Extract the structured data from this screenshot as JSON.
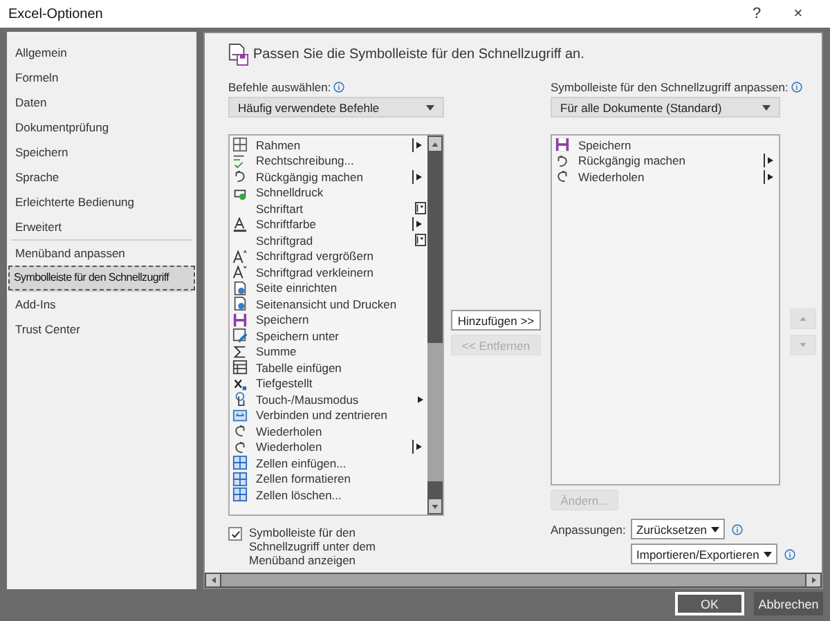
{
  "window": {
    "title": "Excel-Optionen",
    "help": "?",
    "close": "×"
  },
  "sidebar": {
    "groups": [
      [
        {
          "label": "Allgemein",
          "selected": false
        },
        {
          "label": "Formeln",
          "selected": false
        },
        {
          "label": "Daten",
          "selected": false
        },
        {
          "label": "Dokumentprüfung",
          "selected": false
        },
        {
          "label": "Speichern",
          "selected": false
        },
        {
          "label": "Sprache",
          "selected": false
        },
        {
          "label": "Erleichterte Bedienung",
          "selected": false
        },
        {
          "label": "Erweitert",
          "selected": false
        }
      ],
      [
        {
          "label": "Menüband anpassen",
          "selected": false
        },
        {
          "label": "Symbolleiste für den Schnellzugriff",
          "selected": true
        }
      ],
      [
        {
          "label": "Add-Ins",
          "selected": false
        },
        {
          "label": "Trust Center",
          "selected": false
        }
      ]
    ]
  },
  "header": "Passen Sie die Symbolleiste für den Schnellzugriff an.",
  "commands": {
    "label": "Befehle auswählen:",
    "dropdown": "Häufig verwendete Befehle",
    "items": [
      {
        "label": "Rahmen",
        "submenu": true,
        "split": true
      },
      {
        "label": "Rechtschreibung..."
      },
      {
        "label": "Rückgängig machen",
        "submenu": true,
        "split": true
      },
      {
        "label": "Schnelldruck"
      },
      {
        "label": "Schriftart",
        "combo": true
      },
      {
        "label": "Schriftfarbe",
        "submenu": true,
        "split": true
      },
      {
        "label": "Schriftgrad",
        "combo": true
      },
      {
        "label": "Schriftgrad vergrößern"
      },
      {
        "label": "Schriftgrad verkleinern"
      },
      {
        "label": "Seite einrichten"
      },
      {
        "label": "Seitenansicht und Drucken"
      },
      {
        "label": "Speichern"
      },
      {
        "label": "Speichern unter"
      },
      {
        "label": "Summe"
      },
      {
        "label": "Tabelle einfügen"
      },
      {
        "label": "Tiefgestellt"
      },
      {
        "label": "Touch-/Mausmodus",
        "submenu": true,
        "split": false
      },
      {
        "label": "Verbinden und zentrieren"
      },
      {
        "label": "Wiederholen"
      },
      {
        "label": "Wiederholen",
        "submenu": true,
        "split": true
      },
      {
        "label": "Zellen einfügen..."
      },
      {
        "label": "Zellen formatieren"
      },
      {
        "label": "Zellen löschen..."
      }
    ],
    "checkbox": {
      "label": "Symbolleiste für den Schnellzugriff unter dem Menüband anzeigen",
      "checked": true
    }
  },
  "add_button": {
    "label": "Hinzufügen >>",
    "disabled": false
  },
  "remove_button": {
    "label": "<< Entfernen",
    "disabled": true
  },
  "toolbar": {
    "label": "Symbolleiste für den Schnellzugriff anpassen:",
    "dropdown": "Für alle Dokumente (Standard)",
    "items": [
      {
        "label": "Speichern"
      },
      {
        "label": "Rückgängig machen",
        "submenu": true,
        "split": true
      },
      {
        "label": "Wiederholen",
        "submenu": true,
        "split": true
      }
    ],
    "modify_button": {
      "label": "Ändern...",
      "disabled": true
    },
    "move_up": {
      "disabled": true
    },
    "move_down": {
      "disabled": true
    },
    "customizations_label": "Anpassungen:",
    "reset": "Zurücksetzen",
    "import_export": "Importieren/Exportieren"
  },
  "buttons": [
    {
      "label": "OK",
      "default": true
    },
    {
      "label": "Abbrechen",
      "default": false
    }
  ]
}
